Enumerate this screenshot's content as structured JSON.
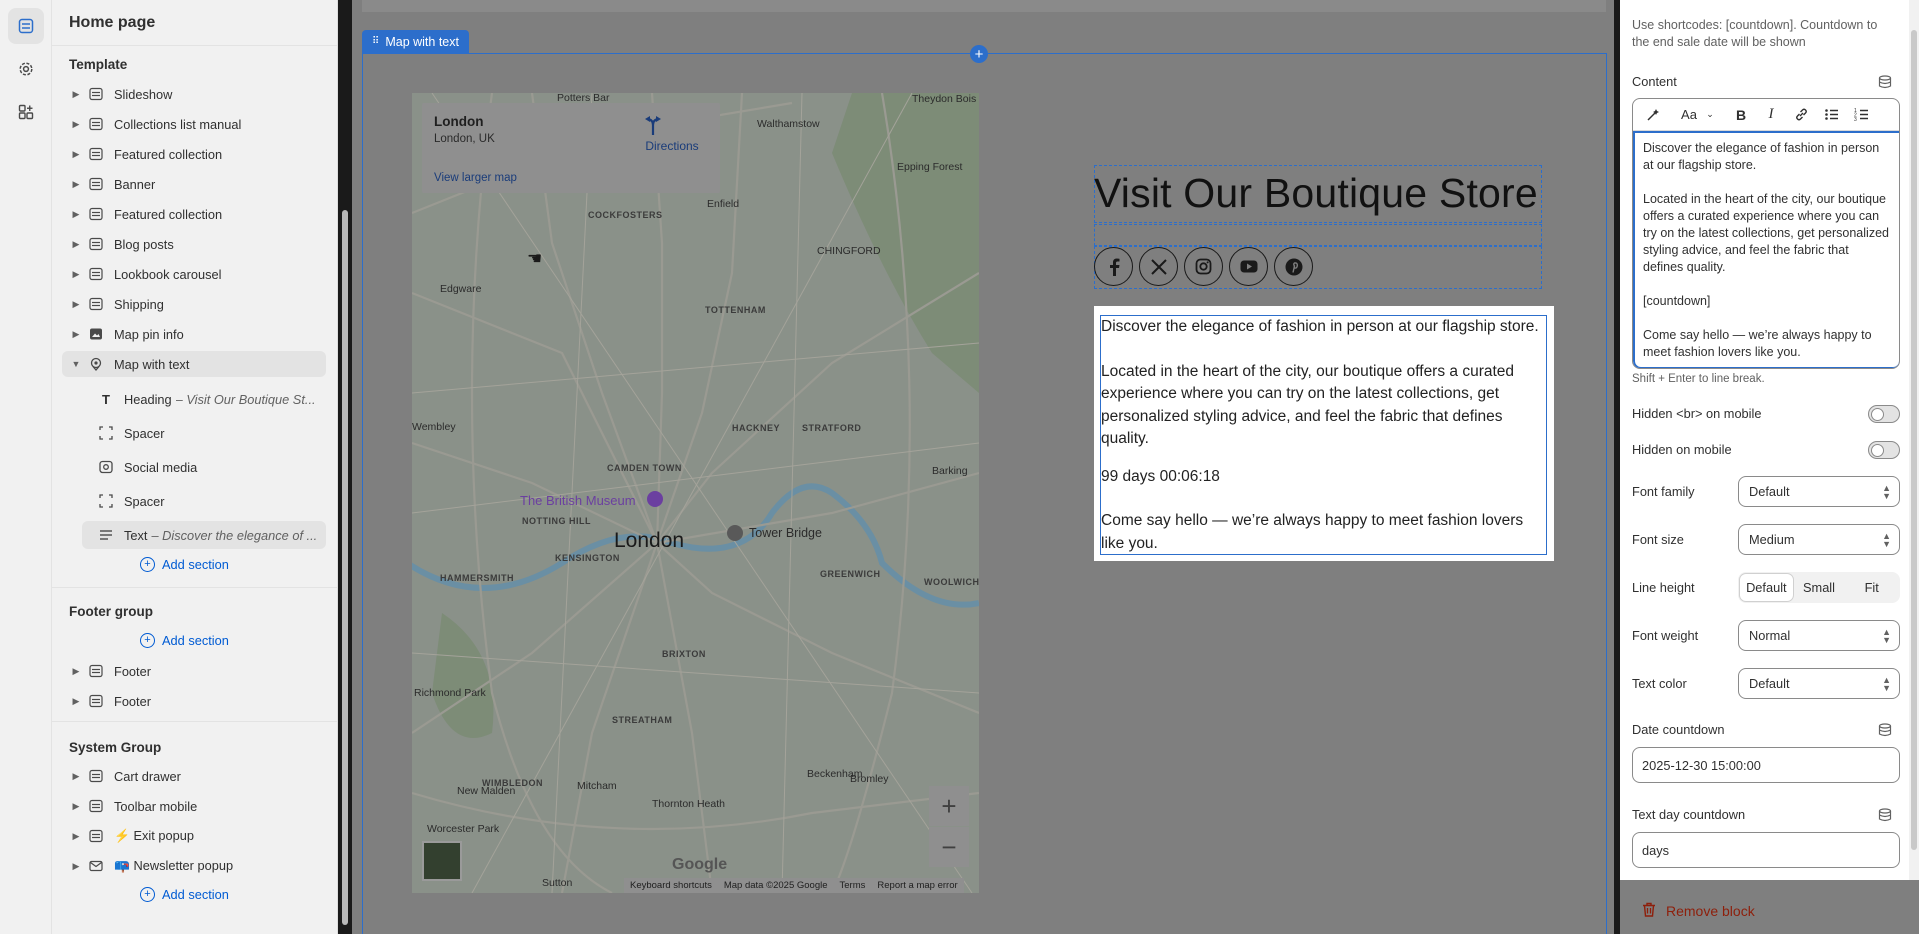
{
  "sidebar": {
    "title": "Home page",
    "template_label": "Template",
    "template_items": [
      {
        "label": "Slideshow"
      },
      {
        "label": "Collections list manual"
      },
      {
        "label": "Featured collection"
      },
      {
        "label": "Banner"
      },
      {
        "label": "Featured collection"
      },
      {
        "label": "Blog posts"
      },
      {
        "label": "Lookbook carousel"
      },
      {
        "label": "Shipping"
      },
      {
        "label": "Map pin info"
      },
      {
        "label": "Map with text"
      }
    ],
    "map_children": [
      {
        "label": "Heading",
        "detail": "– Visit Our Boutique St..."
      },
      {
        "label": "Spacer",
        "detail": ""
      },
      {
        "label": "Social media",
        "detail": ""
      },
      {
        "label": "Spacer",
        "detail": ""
      },
      {
        "label": "Text",
        "detail": "– Discover the elegance of ..."
      }
    ],
    "add_section": "Add section",
    "footer_group_label": "Footer group",
    "footer_items": [
      {
        "label": "Footer"
      },
      {
        "label": "Footer"
      }
    ],
    "system_group_label": "System Group",
    "system_items": [
      {
        "label": "Cart drawer"
      },
      {
        "label": "Toolbar mobile"
      },
      {
        "label": "⚡ Exit popup"
      },
      {
        "label": "📪 Newsletter popup"
      }
    ]
  },
  "preview": {
    "section_tag": "Map with text",
    "map": {
      "place": "London",
      "address": "London, UK",
      "directions": "Directions",
      "larger_map": "View larger map",
      "city_label": "London",
      "museum_label": "The British Museum",
      "tower_label": "Tower Bridge",
      "areas": [
        "Potters Bar",
        "Walthamstow",
        "Enfield",
        "CHINGFORD",
        "Epping Forest",
        "Edgware",
        "TOTTENHAM",
        "HACKNEY",
        "STRATFORD",
        "CAMDEN TOWN",
        "NOTTING HILL",
        "KENSINGTON",
        "HAMMERSMITH",
        "GREENWICH",
        "WOOLWICH",
        "BRIXTON",
        "STREATHAM",
        "WIMBLEDON",
        "Richmond Park",
        "Mitcham",
        "Beckenham",
        "Bromley",
        "New Malden",
        "Thornton Heath",
        "Worcester Park",
        "Sutton",
        "Barking",
        "Wembley",
        "COCKFOSTERS",
        "Theydon Bois"
      ],
      "attrib": [
        "Keyboard shortcuts",
        "Map data ©2025 Google",
        "Terms",
        "Report a map error"
      ],
      "google": "Google"
    },
    "heading": "Visit Our Boutique Store",
    "social_icons": [
      "facebook-icon",
      "x-icon",
      "instagram-icon",
      "youtube-icon",
      "pinterest-icon"
    ],
    "text": {
      "p1": "Discover the elegance of fashion in person at our flagship store.",
      "p2": "Located in the heart of the city, our boutique offers a curated experience where you can try on the latest collections, get personalized styling advice, and feel the fabric that defines quality.",
      "countdown": "99 days 00:06:18",
      "p3": "Come say hello — we’re always happy to meet fashion lovers like you."
    }
  },
  "panel": {
    "help": "Use shortcodes: [countdown]. Countdown to the end sale date will be shown",
    "content_label": "Content",
    "editor": {
      "p1": "Discover the elegance of fashion in person at our flagship store.",
      "p2": "Located in the heart of the city, our boutique offers a curated experience where you can try on the latest collections, get personalized styling advice, and feel the fabric that defines quality.",
      "p3": "[countdown]",
      "p4": "Come say hello — we’re always happy to meet fashion lovers like you."
    },
    "hint": "Shift + Enter to line break.",
    "hidden_br_label": "Hidden <br> on mobile",
    "hidden_mobile_label": "Hidden on mobile",
    "font_family": {
      "label": "Font family",
      "value": "Default"
    },
    "font_size": {
      "label": "Font size",
      "value": "Medium"
    },
    "line_height": {
      "label": "Line height",
      "options": [
        "Default",
        "Small",
        "Fit"
      ],
      "selected": "Default"
    },
    "font_weight": {
      "label": "Font weight",
      "value": "Normal"
    },
    "text_color": {
      "label": "Text color",
      "value": "Default"
    },
    "date_countdown": {
      "label": "Date countdown",
      "value": "2025-12-30 15:00:00"
    },
    "text_day_countdown": {
      "label": "Text day countdown",
      "value": "days"
    },
    "remove": "Remove block"
  },
  "colors": {
    "accent": "#2c6ecb",
    "link": "#005bd3",
    "danger": "#8e1f0b"
  }
}
